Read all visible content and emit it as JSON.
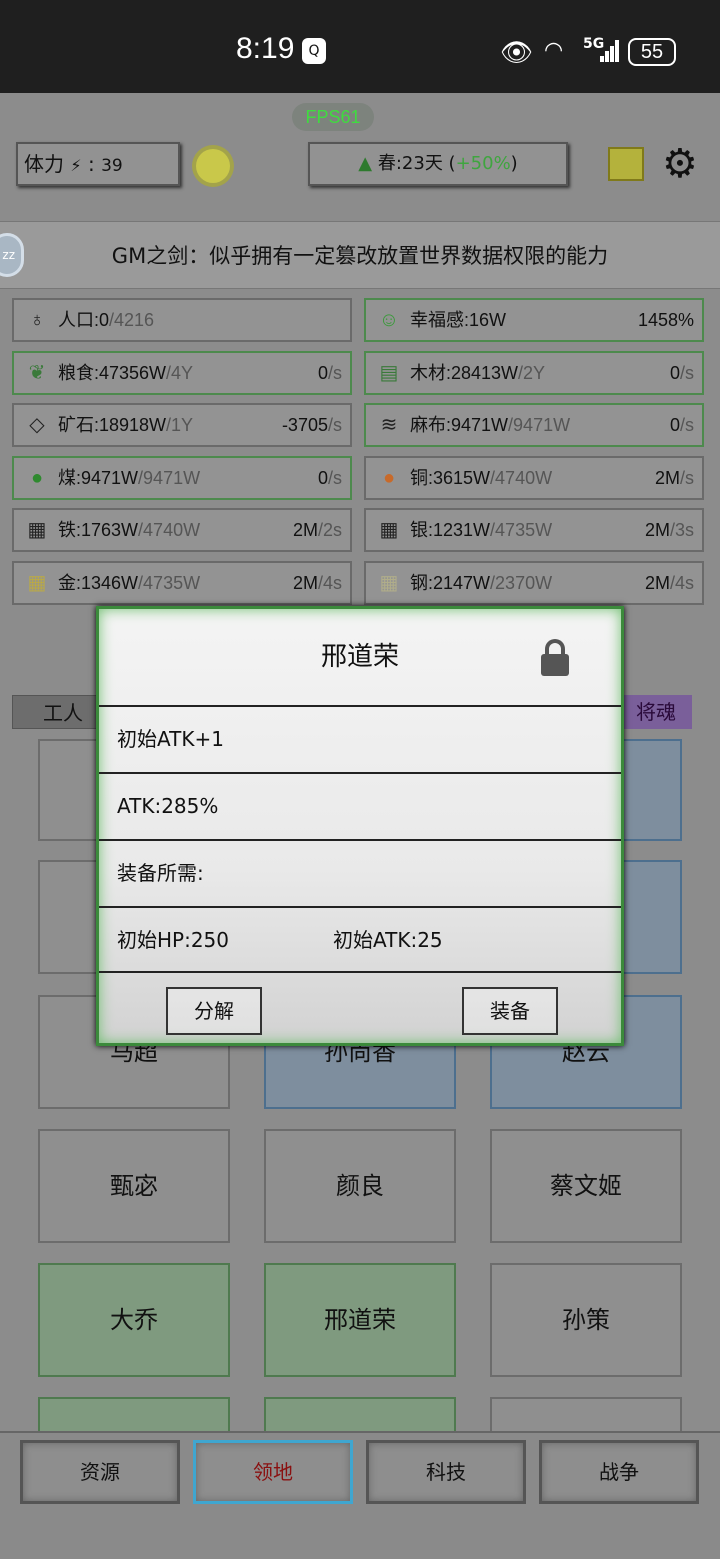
{
  "status_bar": {
    "time": "8:19",
    "qq_icon": "Q",
    "network": "5G",
    "battery": "55"
  },
  "fps": "FPS61",
  "stamina": {
    "label": "体力",
    "bolt": "⚡",
    "sep": ":",
    "value": "39"
  },
  "season": {
    "text": "春:23天",
    "open": " (",
    "bonus": "+50%",
    "close": ")"
  },
  "description": "GM之剑：似乎拥有一定篡改放置世界数据权限的能力",
  "zz_badge": "zz",
  "resources": [
    {
      "icon": "people-icon",
      "name": "人口:0",
      "max": "/4216",
      "rate": "",
      "unit": ""
    },
    {
      "icon": "smile-icon",
      "name": "幸福感:16W",
      "max": "",
      "rate": "1458%",
      "unit": ""
    },
    {
      "icon": "grain-icon",
      "name": "粮食:47356W",
      "max": "/4Y",
      "rate": "0",
      "unit": "/s"
    },
    {
      "icon": "wood-icon",
      "name": "木材:28413W",
      "max": "/2Y",
      "rate": "0",
      "unit": "/s"
    },
    {
      "icon": "ore-icon",
      "name": "矿石:18918W",
      "max": "/1Y",
      "rate": "-3705",
      "unit": "/s"
    },
    {
      "icon": "linen-icon",
      "name": "麻布:9471W",
      "max": "/9471W",
      "rate": "0",
      "unit": "/s"
    },
    {
      "icon": "coal-icon",
      "name": "煤:9471W",
      "max": "/9471W",
      "rate": "0",
      "unit": "/s"
    },
    {
      "icon": "copper-icon",
      "name": "铜:3615W",
      "max": "/4740W",
      "rate": "2M",
      "unit": "/s"
    },
    {
      "icon": "iron-icon",
      "name": "铁:1763W",
      "max": "/4740W",
      "rate": "2M",
      "unit": "/2s"
    },
    {
      "icon": "silver-icon",
      "name": "银:1231W",
      "max": "/4735W",
      "rate": "2M",
      "unit": "/3s"
    },
    {
      "icon": "gold-icon",
      "name": "金:1346W",
      "max": "/4735W",
      "rate": "2M",
      "unit": "/4s"
    },
    {
      "icon": "steel-icon",
      "name": "钢:2147W",
      "max": "/2370W",
      "rate": "2M",
      "unit": "/4s"
    }
  ],
  "tabs": {
    "left": "工人",
    "right": "将魂"
  },
  "generals": [
    {
      "name": "马超",
      "style": "plain"
    },
    {
      "name": "孙尚香",
      "style": "blue"
    },
    {
      "name": "赵云",
      "style": "blue"
    },
    {
      "name": "甄宓",
      "style": "plain"
    },
    {
      "name": "颜良",
      "style": "plain"
    },
    {
      "name": "蔡文姬",
      "style": "plain"
    },
    {
      "name": "大乔",
      "style": "green"
    },
    {
      "name": "邢道荣",
      "style": "green"
    },
    {
      "name": "孙策",
      "style": "plain"
    }
  ],
  "dialog": {
    "title": "邢道荣",
    "row1": "初始ATK+1",
    "row2": "ATK:285%",
    "row3": "装备所需:",
    "row4_a": "初始HP:250",
    "row4_b": "初始ATK:25",
    "decompose": "分解",
    "equip": "装备"
  },
  "bottom_nav": [
    "资源",
    "领地",
    "科技",
    "战争"
  ]
}
